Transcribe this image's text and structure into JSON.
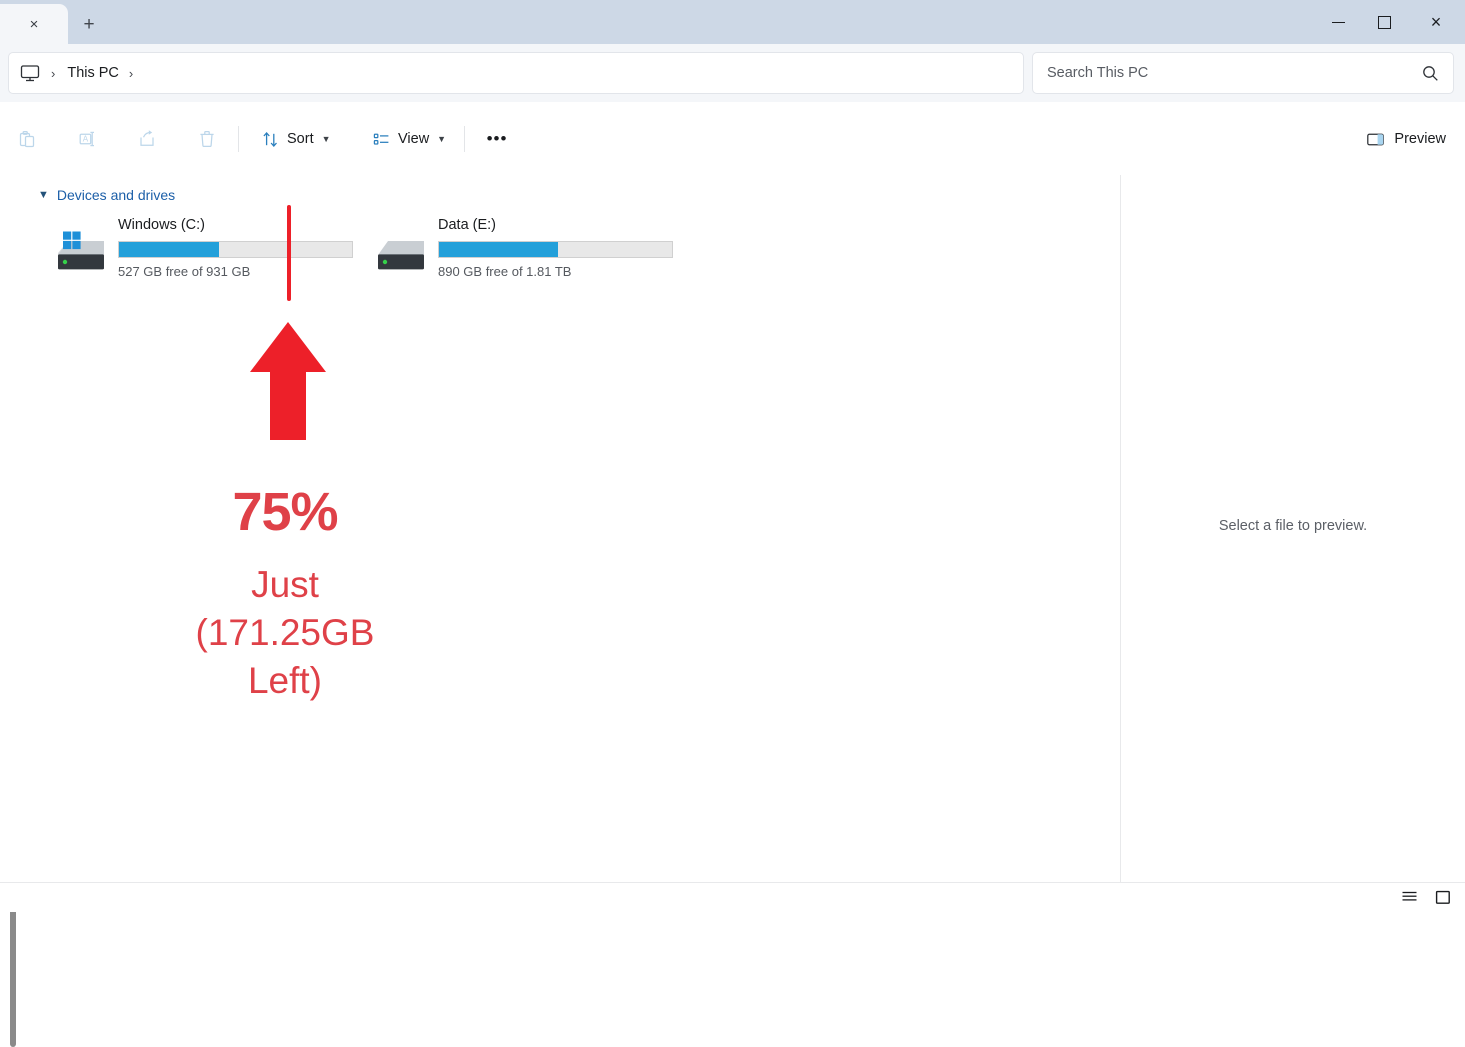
{
  "window": {
    "tab_close_label": "×",
    "new_tab_label": "+",
    "minimize_label": "",
    "maximize_label": "",
    "close_label": "×"
  },
  "address": {
    "root_icon": "this-pc-icon",
    "separator": "›",
    "crumb": "This PC",
    "trailing_separator": "›"
  },
  "search": {
    "placeholder": "Search This PC",
    "value": "",
    "icon": "search-icon"
  },
  "toolbar": {
    "paste_label": "",
    "rename_label": "",
    "share_label": "",
    "delete_label": "",
    "sort_label": "Sort",
    "view_label": "View",
    "overflow_label": "•••",
    "chevron": "⌄",
    "preview_label": "Preview"
  },
  "main": {
    "group_title": "Devices and drives",
    "group_chevron": "⌄",
    "drives": [
      {
        "name": "Windows (C:)",
        "capacity_text": "527 GB free of 931 GB",
        "used_percent": 43,
        "has_windows_badge": true
      },
      {
        "name": "Data (E:)",
        "capacity_text": "890 GB free of 1.81 TB",
        "used_percent": 51,
        "has_windows_badge": false
      }
    ]
  },
  "annotation": {
    "percent": "75%",
    "line1": "Just",
    "line2": "(171.25GB",
    "line3": "Left)",
    "text_color": "#df4148",
    "arrow_color": "#ed2029"
  },
  "preview": {
    "message": "Select a file to preview."
  },
  "status": {
    "details_view_icon": "details-view-icon",
    "large_icons_view_icon": "large-icons-view-icon"
  },
  "colors": {
    "titlebar": "#cdd8e6",
    "addressbar": "#f4f6f9",
    "drive_bar_fill": "#23a0da",
    "group_title": "#1c5fa8"
  }
}
